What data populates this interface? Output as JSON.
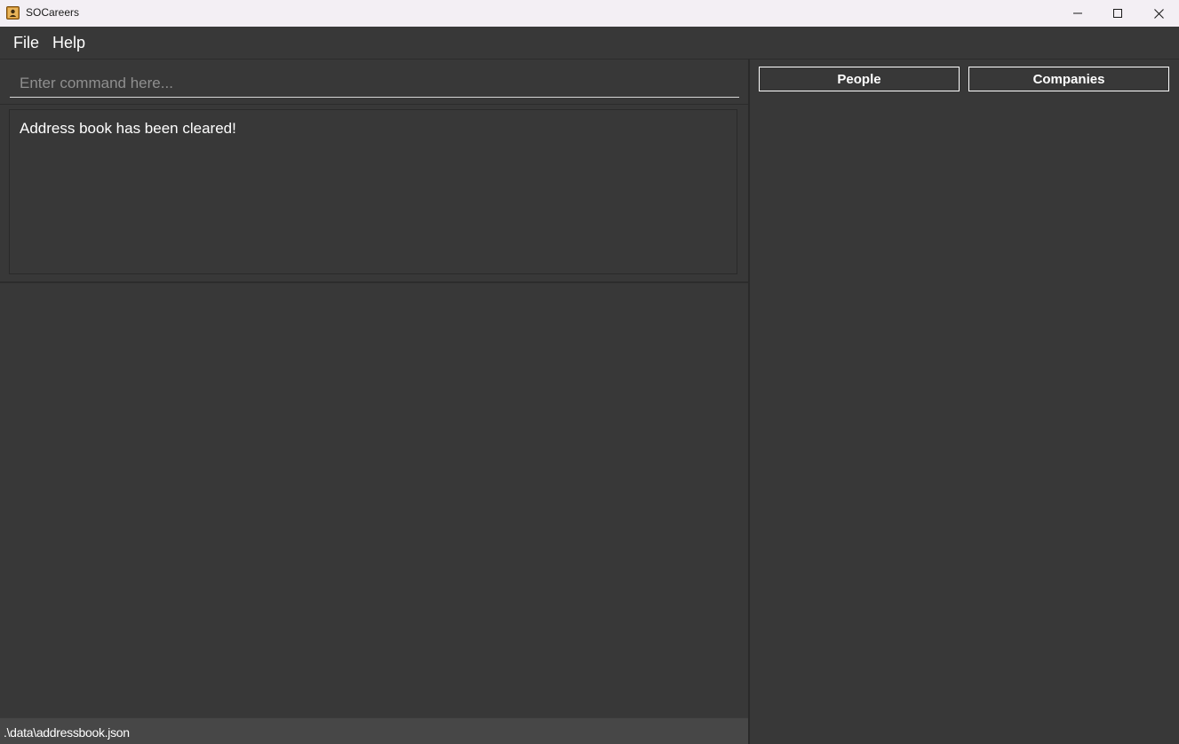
{
  "window": {
    "title": "SOCareers",
    "icon": "address-book-icon"
  },
  "menu": {
    "file_label": "File",
    "help_label": "Help"
  },
  "command": {
    "placeholder": "Enter command here...",
    "value": ""
  },
  "result": {
    "message": "Address book has been cleared!"
  },
  "tabs": {
    "people_label": "People",
    "companies_label": "Companies"
  },
  "status": {
    "file_path": ".\\data\\addressbook.json"
  },
  "colors": {
    "background": "#383838",
    "titlebar": "#f3eff4",
    "statusbar": "#474747",
    "text": "#ffffff"
  }
}
